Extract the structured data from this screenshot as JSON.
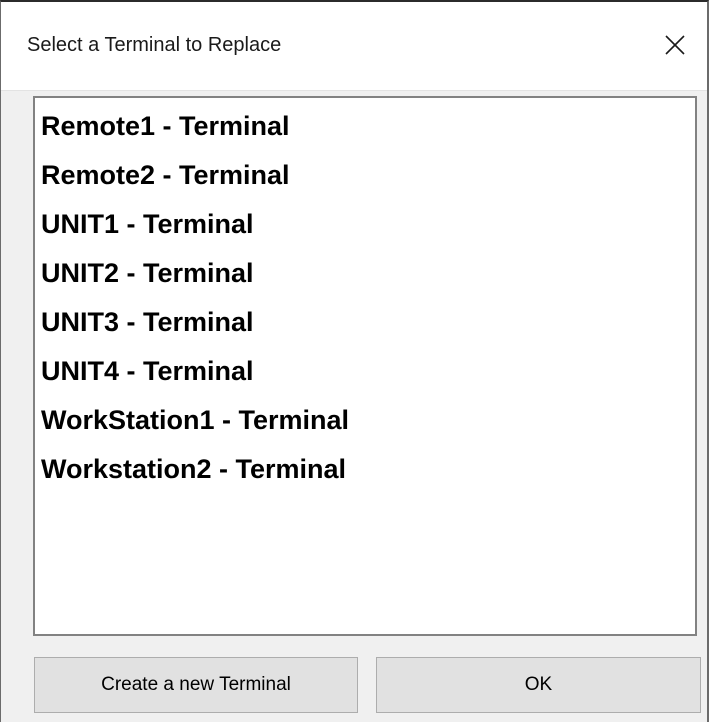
{
  "dialog": {
    "title": "Select a Terminal to Replace",
    "close_icon": "close-icon"
  },
  "terminals": [
    "Remote1 - Terminal",
    "Remote2 - Terminal",
    "UNIT1 - Terminal",
    "UNIT2 - Terminal",
    "UNIT3 - Terminal",
    "UNIT4 - Terminal",
    "WorkStation1 - Terminal",
    "Workstation2 - Terminal"
  ],
  "buttons": {
    "create_label": "Create a new Terminal",
    "ok_label": "OK"
  }
}
